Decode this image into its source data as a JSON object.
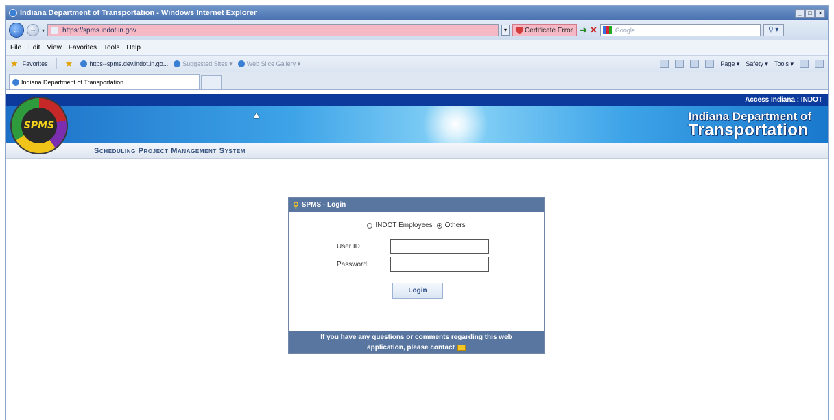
{
  "browser": {
    "title": "Indiana Department of Transportation - Windows Internet Explorer",
    "window_buttons": [
      "_",
      "□",
      "×"
    ],
    "url": "https://spms.indot.in.gov",
    "cert_error": "Certificate Error",
    "search_placeholder": "Google",
    "menu": [
      "File",
      "Edit",
      "View",
      "Favorites",
      "Tools",
      "Help"
    ],
    "favorites_label": "Favorites",
    "favorites": [
      {
        "label": "https--spms.dev.indot.in.go...",
        "dim": false
      },
      {
        "label": "Suggested Sites ▾",
        "dim": true
      },
      {
        "label": "Web Slice Gallery ▾",
        "dim": true
      }
    ],
    "commands": [
      "Page ▾",
      "Safety ▾",
      "Tools ▾"
    ],
    "tab_title": "Indiana Department of Transportation"
  },
  "site": {
    "top_link": "Access Indiana  :  INDOT",
    "brand_line1": "Indiana Department of",
    "brand_line2": "Transportation",
    "system_name": "Scheduling Project Management System",
    "logo_text": "SPMS"
  },
  "login": {
    "header": "SPMS - Login",
    "radio_employees": "INDOT Employees",
    "radio_others": "Others",
    "selected": "others",
    "user_id_label": "User ID",
    "password_label": "Password",
    "user_id_value": "",
    "password_value": "",
    "button": "Login",
    "footer_line1": "If you have any questions or comments regarding this web",
    "footer_line2": "application, please contact"
  }
}
